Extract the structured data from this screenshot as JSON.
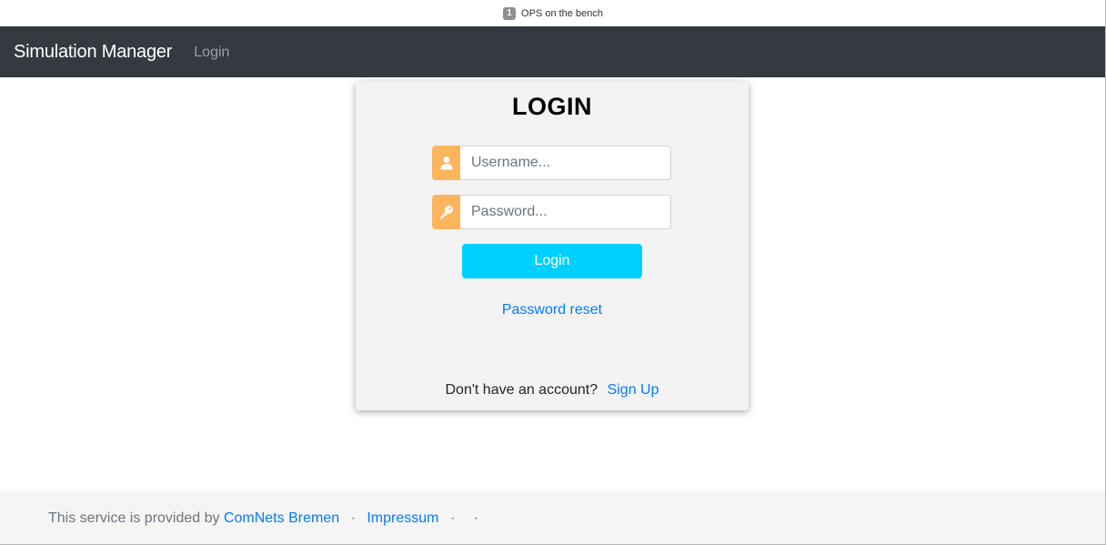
{
  "window": {
    "tab_badge": "1",
    "tab_title": "OPS on the bench"
  },
  "navbar": {
    "brand": "Simulation Manager",
    "login_link": "Login"
  },
  "login": {
    "title": "LOGIN",
    "username_placeholder": "Username...",
    "password_placeholder": "Password...",
    "submit_label": "Login",
    "password_reset": "Password reset",
    "no_account_text": "Don't have an account?",
    "signup_link": "Sign Up"
  },
  "footer": {
    "provided_by_text": "This service is provided by",
    "provider_link": "ComNets Bremen",
    "separator": "·",
    "impressum_link": "Impressum"
  },
  "colors": {
    "navbar_bg": "#343a40",
    "addon_orange": "#fdb55d",
    "button_cyan": "#00d0ff",
    "link_blue": "#007bff"
  },
  "icons": {
    "username": "user-icon",
    "password": "key-icon"
  }
}
